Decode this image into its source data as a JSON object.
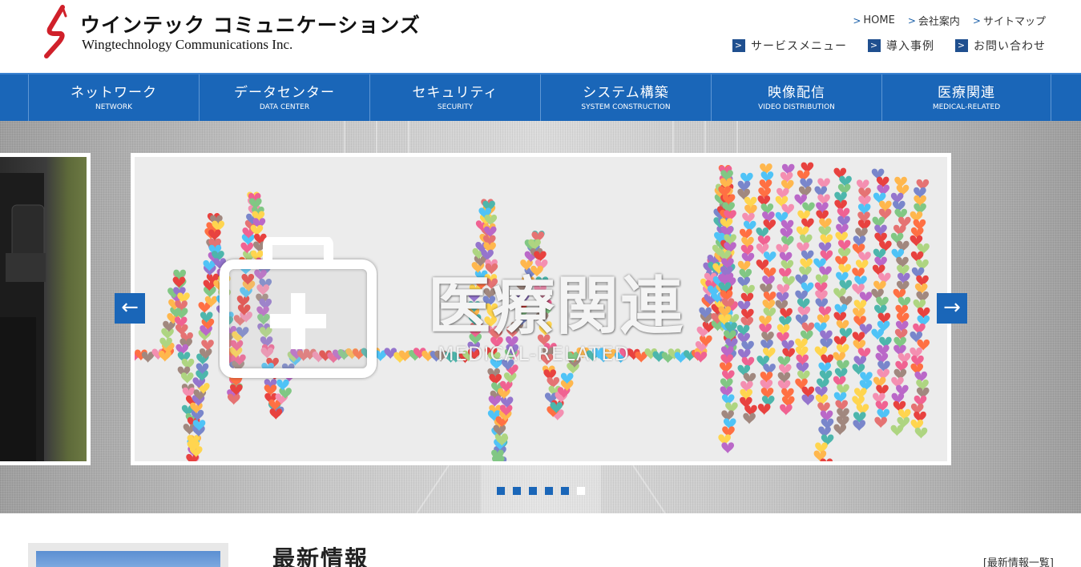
{
  "header": {
    "logo_jp": "ウインテック コミュニケーションズ",
    "logo_en": "Wingtechnology Communications Inc.",
    "util_links": [
      {
        "label": "HOME"
      },
      {
        "label": "会社案内"
      },
      {
        "label": "サイトマップ"
      }
    ],
    "service_links": [
      {
        "label": "サービスメニュー"
      },
      {
        "label": "導入事例"
      },
      {
        "label": "お問い合わせ"
      }
    ]
  },
  "nav": [
    {
      "jp": "ネットワーク",
      "en": "NETWORK"
    },
    {
      "jp": "データセンター",
      "en": "DATA CENTER"
    },
    {
      "jp": "セキュリティ",
      "en": "SECURITY"
    },
    {
      "jp": "システム構築",
      "en": "SYSTEM CONSTRUCTION"
    },
    {
      "jp": "映像配信",
      "en": "VIDEO DISTRIBUTION"
    },
    {
      "jp": "医療関連",
      "en": "MEDICAL-RELATED"
    }
  ],
  "slider": {
    "title": "医療関連",
    "subtitle": "MEDICAL-RELATED",
    "prev_icon": "arrow-left-icon",
    "next_icon": "arrow-right-icon",
    "slide_count": 6,
    "active_index": 6
  },
  "news": {
    "title": "最新情報",
    "all_link": "[最新情報一覧]"
  },
  "colors": {
    "brand_blue": "#1a66b8",
    "logo_red": "#d0202a"
  }
}
